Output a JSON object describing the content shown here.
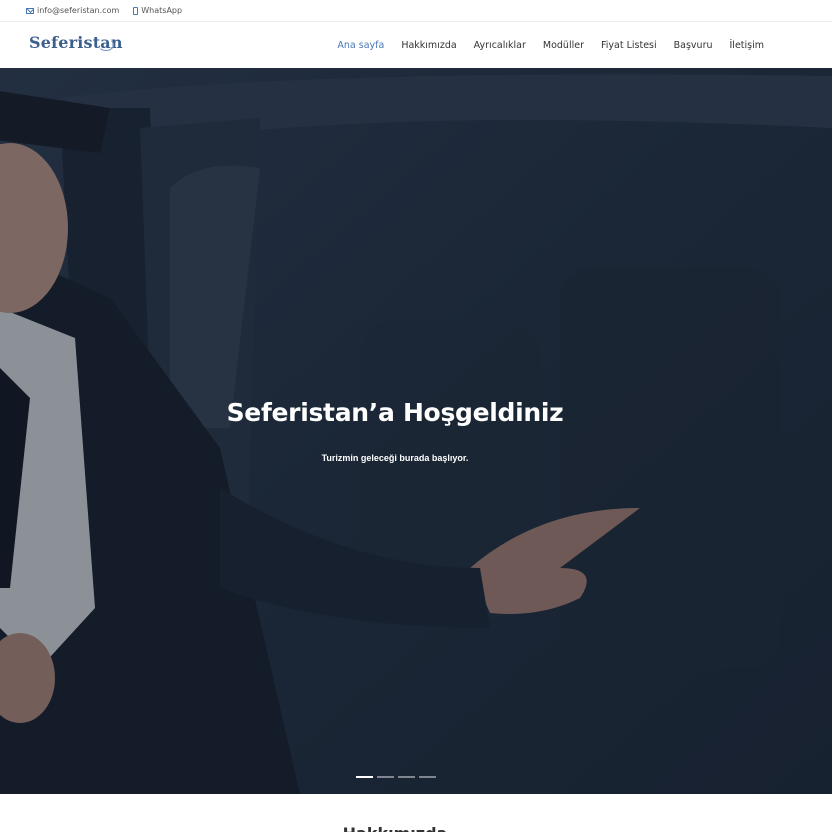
{
  "topbar": {
    "email": "info@seferistan.com",
    "whatsapp": "WhatsApp",
    "email_icon": "mail-icon",
    "whatsapp_icon": "phone-icon"
  },
  "header": {
    "logo_text": "Seferistan",
    "nav": [
      {
        "label": "Ana sayfa",
        "active": true
      },
      {
        "label": "Hakkımızda",
        "active": false
      },
      {
        "label": "Ayrıcalıklar",
        "active": false
      },
      {
        "label": "Modüller",
        "active": false
      },
      {
        "label": "Fiyat Listesi",
        "active": false
      },
      {
        "label": "Başvuru",
        "active": false
      },
      {
        "label": "İletişim",
        "active": false
      }
    ]
  },
  "hero": {
    "title": "Seferistan’a Hoşgeldiniz",
    "subtitle": "Turizmin geleceği burada başlıyor.",
    "slides": 4,
    "active_slide": 1
  },
  "next_section": {
    "heading": "Hakkımızda"
  },
  "colors": {
    "accent": "#4a77b4",
    "hero_bg": "#22303f",
    "logo": "#3c5f8e"
  }
}
